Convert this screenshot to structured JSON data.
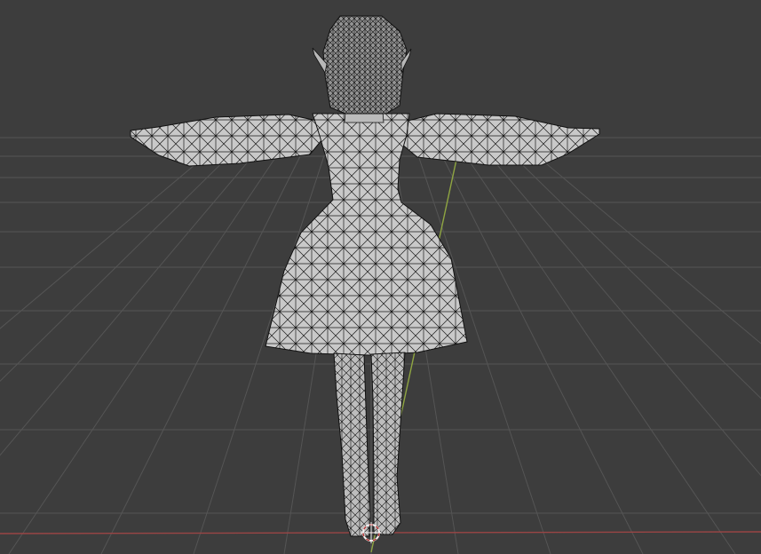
{
  "viewport": {
    "background_color": "#3d3d3d",
    "grid_color": "#555555",
    "x_axis_color": "#9a4545",
    "y_axis_color": "#8fa542",
    "cursor_outer_color": "#f2f2f2",
    "cursor_inner_color": "#b73a3a"
  },
  "model": {
    "fill_color": "#c9c9c9",
    "wire_color": "#1a1a1a",
    "shade_color": "#a9a9a9"
  }
}
